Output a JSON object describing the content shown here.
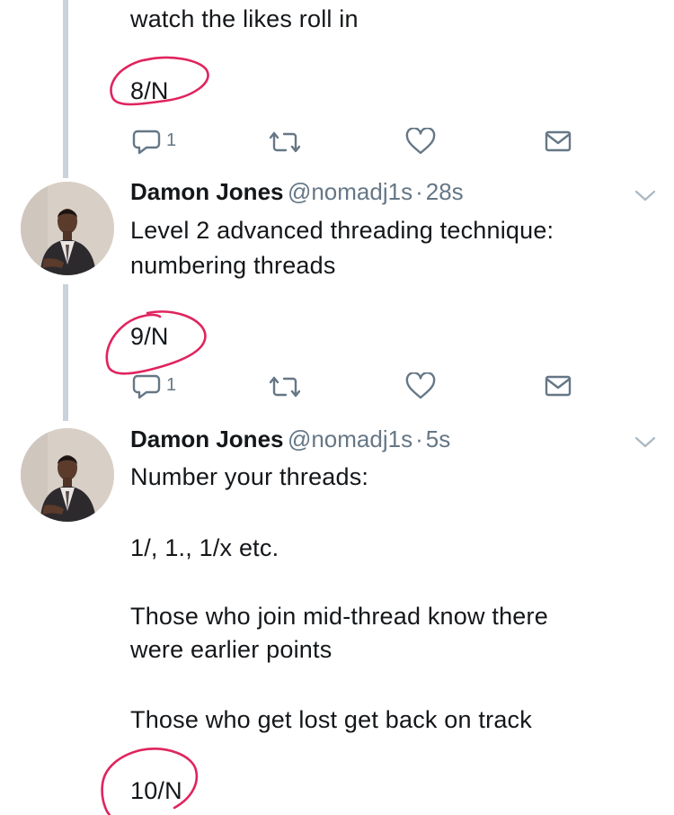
{
  "tweets": [
    {
      "text_lines": [
        "watch the likes roll in"
      ],
      "number_label": "8/N",
      "reply_count": "1"
    },
    {
      "author": "Damon Jones",
      "handle": "@nomadj1s",
      "separator": "·",
      "time": "28s",
      "text_lines": [
        "Level 2 advanced threading technique:",
        "numbering threads"
      ],
      "number_label": "9/N",
      "reply_count": "1"
    },
    {
      "author": "Damon Jones",
      "handle": "@nomadj1s",
      "separator": "·",
      "time": "5s",
      "text_lines": [
        "Number your threads:",
        "1/, 1., 1/x etc.",
        "Those who join mid-thread know there",
        "were earlier points",
        "Those who get lost get back on track"
      ],
      "number_label": "10/N"
    }
  ],
  "colors": {
    "icon": "#657786",
    "thread_line": "#c9d3dc",
    "annotation": "#e0245e"
  },
  "icons": [
    "reply-icon",
    "retweet-icon",
    "like-icon",
    "message-icon",
    "chevron-down-icon"
  ]
}
